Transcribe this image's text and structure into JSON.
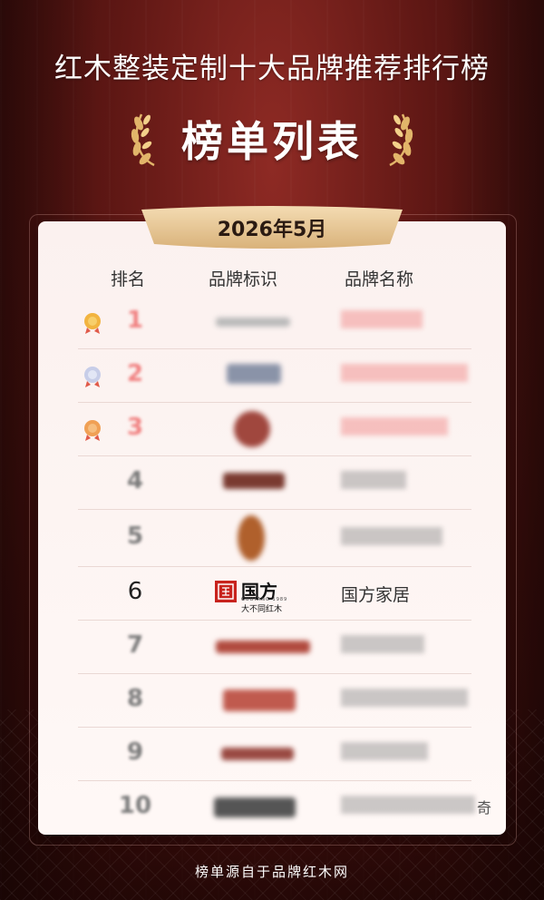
{
  "header": {
    "title": "红木整装定制十大品牌推荐排行榜",
    "subtitle": "榜单列表",
    "date": "2026年5月"
  },
  "columns": {
    "rank": "排名",
    "logo": "品牌标识",
    "name": "品牌名称"
  },
  "ranking": [
    {
      "rank": "1",
      "name": "",
      "medal": "gold-medal-icon",
      "color": "#f08080"
    },
    {
      "rank": "2",
      "name": "",
      "medal": "silver-medal-icon",
      "color": "#f08080"
    },
    {
      "rank": "3",
      "name": "",
      "medal": "bronze-medal-icon",
      "color": "#f08080"
    },
    {
      "rank": "4",
      "name": "",
      "color": "#7a7a7a"
    },
    {
      "rank": "5",
      "name": "",
      "color": "#7a7a7a"
    },
    {
      "rank": "6",
      "name": "国方家居",
      "color": "#222222",
      "logo_text": "国方",
      "logo_sub": "GUOFANG·1989",
      "logo_tagline": "大不同红木"
    },
    {
      "rank": "7",
      "name": "",
      "color": "#7a7a7a"
    },
    {
      "rank": "8",
      "name": "",
      "color": "#7a7a7a"
    },
    {
      "rank": "9",
      "name": "",
      "color": "#7a7a7a"
    },
    {
      "rank": "10",
      "name": "",
      "name_tail": "奇",
      "color": "#7a7a7a"
    }
  ],
  "footer": "榜单源自于品牌红木网",
  "colors": {
    "background": "#5e1714",
    "card": "#fdf3f1",
    "ribbon": "#e9cfa4",
    "highlight_rank": "#f08080",
    "logo_red": "#c8231d"
  }
}
